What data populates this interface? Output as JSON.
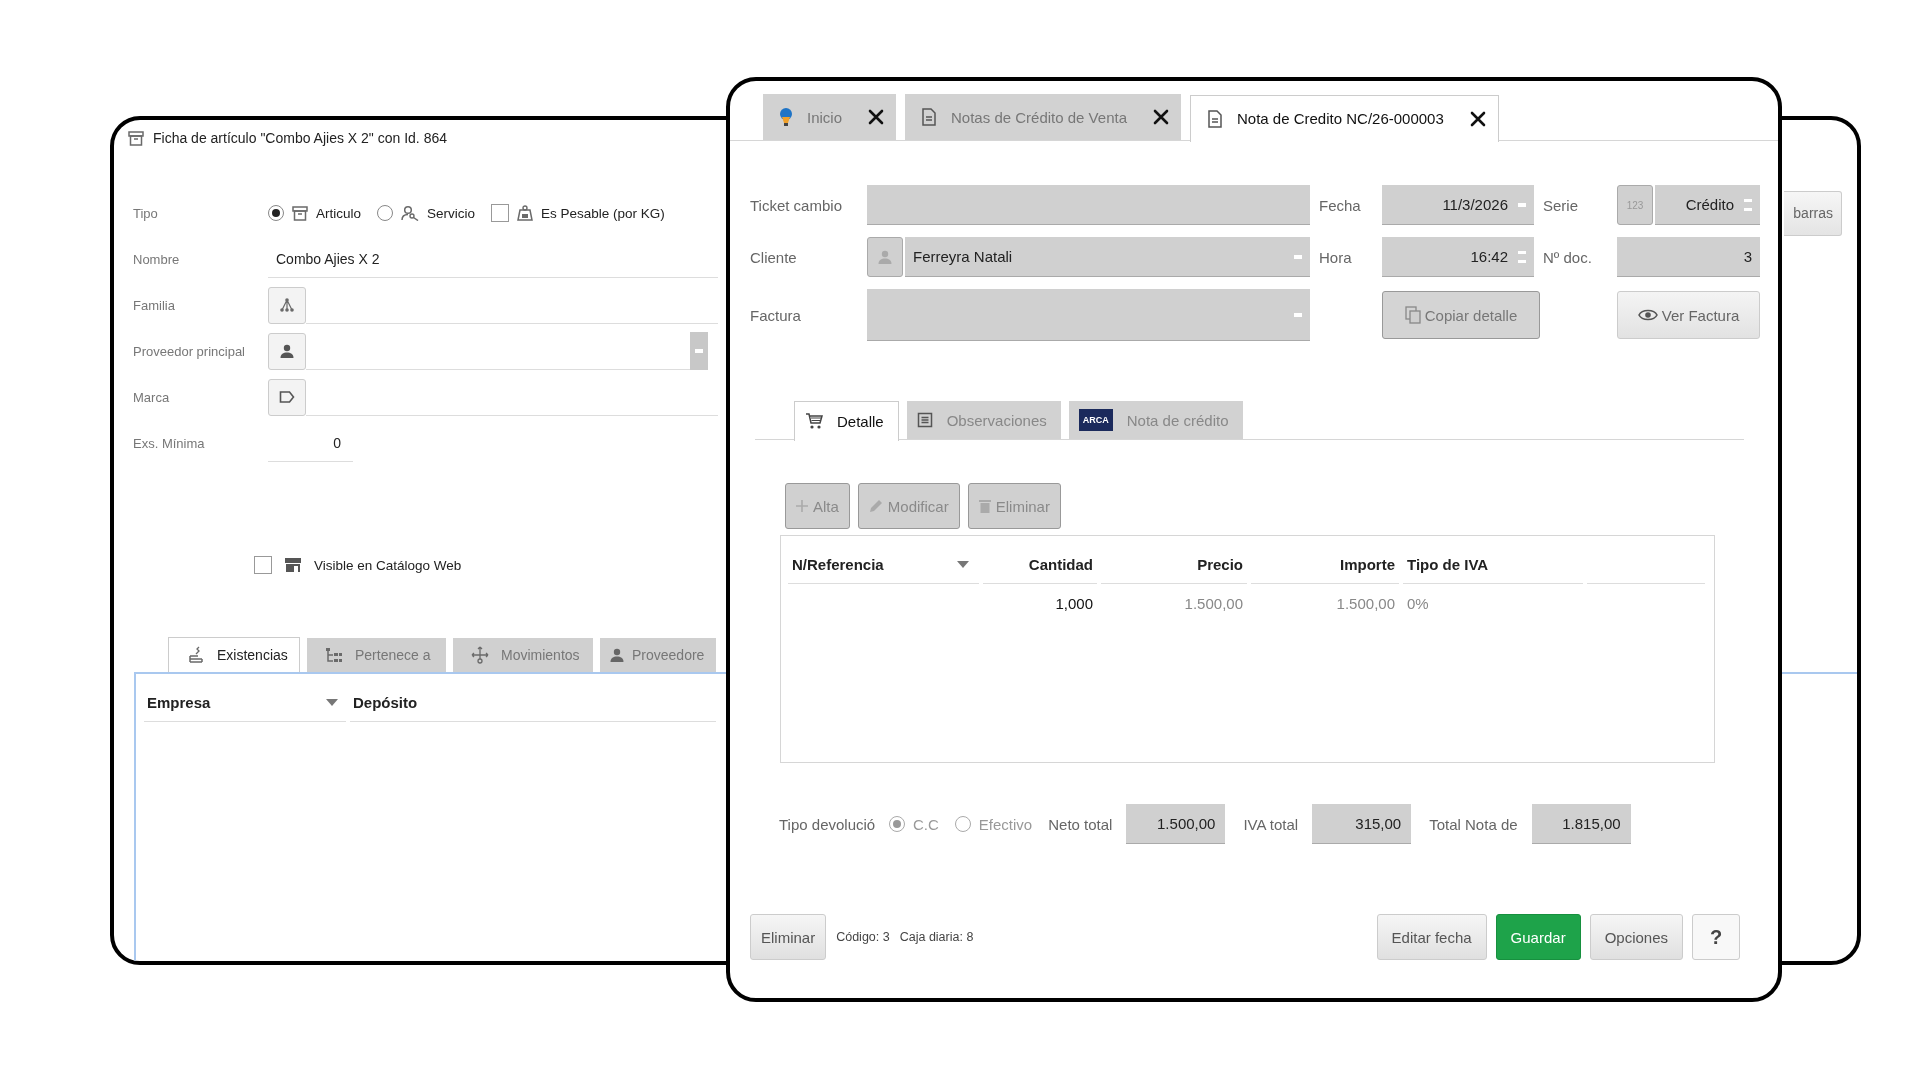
{
  "article_window": {
    "title": "Ficha de artículo \"Combo Ajies X 2\" con Id. 864",
    "tipo": {
      "label": "Tipo",
      "options": [
        {
          "kind": "radio",
          "label": "Articulo",
          "selected": true
        },
        {
          "kind": "radio",
          "label": "Servicio",
          "selected": false
        },
        {
          "kind": "checkbox",
          "label": "Es Pesable (por KG)",
          "checked": false
        }
      ]
    },
    "barcode_button": "barras",
    "nombre": {
      "label": "Nombre",
      "value": "Combo Ajies X 2"
    },
    "familia": {
      "label": "Familia"
    },
    "proveedor": {
      "label": "Proveedor principal"
    },
    "marca": {
      "label": "Marca"
    },
    "exs_minima": {
      "label": "Exs. Mínima",
      "value": "0"
    },
    "visible_web": {
      "label": "Visible en Catálogo Web",
      "checked": false
    },
    "tabs": [
      {
        "label": "Existencias",
        "selected": true
      },
      {
        "label": "Pertenece a",
        "selected": false
      },
      {
        "label": "Movimientos",
        "selected": false
      },
      {
        "label": "Proveedore",
        "selected": false
      }
    ],
    "table": {
      "columns": [
        "Empresa",
        "Depósito"
      ]
    }
  },
  "credit_note_window": {
    "tabs": [
      {
        "label": "Inicio",
        "selected": false
      },
      {
        "label": "Notas de Crédito de Venta",
        "selected": false
      },
      {
        "label": "Nota de Credito NC/26-000003",
        "selected": true
      }
    ],
    "ticket_cambio": {
      "label": "Ticket cambio"
    },
    "fecha": {
      "label": "Fecha",
      "value": "11/3/2026"
    },
    "serie": {
      "label": "Serie",
      "badge": "123",
      "value": "Crédito"
    },
    "cliente": {
      "label": "Cliente",
      "value": "Ferreyra Natali"
    },
    "hora": {
      "label": "Hora",
      "value": "16:42"
    },
    "nro_doc": {
      "label": "Nº doc.",
      "value": "3"
    },
    "factura": {
      "label": "Factura"
    },
    "copy_button": "Copiar detalle",
    "view_button": "Ver Factura",
    "detail_tabs": [
      {
        "label": "Detalle",
        "selected": true
      },
      {
        "label": "Observaciones",
        "selected": false
      },
      {
        "label": "Nota de crédito",
        "selected": false,
        "logo": "ARCA"
      }
    ],
    "grid_buttons": [
      {
        "label": "Alta",
        "disabled": true
      },
      {
        "label": "Modificar",
        "disabled": true
      },
      {
        "label": "Eliminar",
        "disabled": true
      }
    ],
    "grid": {
      "columns": [
        "N/Referencia",
        "Cantidad",
        "Precio",
        "Importe",
        "Tipo de IVA"
      ],
      "rows": [
        {
          "cantidad": "1,000",
          "precio": "1.500,00",
          "importe": "1.500,00",
          "tipo_iva": "0%"
        }
      ]
    },
    "tipo_devolucion": {
      "label": "Tipo devolució",
      "disabled": true,
      "options": [
        {
          "label": "C.C",
          "selected": true
        },
        {
          "label": "Efectivo",
          "selected": false
        }
      ]
    },
    "totals": [
      {
        "label": "Neto total",
        "value": "1.500,00"
      },
      {
        "label": "IVA total",
        "value": "315,00"
      },
      {
        "label": "Total Nota de",
        "value": "1.815,00"
      }
    ],
    "footer": {
      "delete_button": "Eliminar",
      "info": [
        "Código: 3",
        "Caja diaria: 8"
      ],
      "buttons": [
        {
          "kind": "normal",
          "label": "Editar fecha"
        },
        {
          "kind": "primary",
          "label": "Guardar"
        },
        {
          "kind": "normal",
          "label": "Opciones"
        },
        {
          "kind": "help",
          "label": "?"
        }
      ]
    }
  }
}
